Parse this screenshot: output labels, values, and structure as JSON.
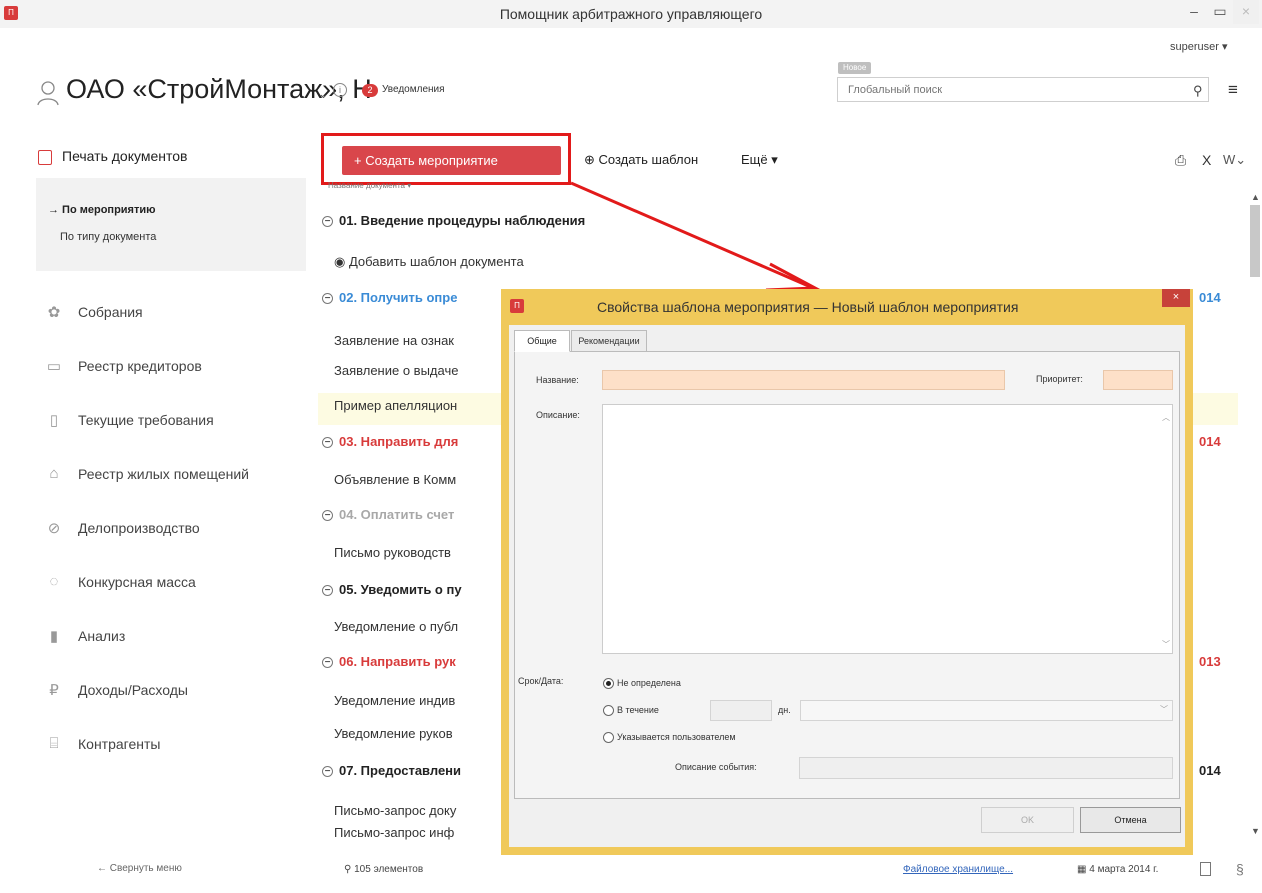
{
  "window": {
    "title": "Помощник арбитражного управляющего",
    "icon": "app-logo-icon"
  },
  "user": {
    "name": "superuser ▾"
  },
  "header": {
    "org_name": "ОАО «СтройМонтаж», Н",
    "notifications_count": "2",
    "notifications_label": "Уведомления",
    "new_tag": "Новое",
    "search_placeholder": "Глобальный поиск"
  },
  "sidebar": {
    "top_item": "Печать документов",
    "sub_items": [
      "→ По мероприятию",
      "По типу документа"
    ],
    "items": [
      {
        "label": "Собрания",
        "icon": "meeting-icon"
      },
      {
        "label": "Реестр кредиторов",
        "icon": "register-icon"
      },
      {
        "label": "Текущие требования",
        "icon": "document-icon"
      },
      {
        "label": "Реестр жилых помещений",
        "icon": "house-icon"
      },
      {
        "label": "Делопроизводство",
        "icon": "paperclip-icon"
      },
      {
        "label": "Конкурсная масса",
        "icon": "box-icon"
      },
      {
        "label": "Анализ",
        "icon": "bar-chart-icon"
      },
      {
        "label": "Доходы/Расходы",
        "icon": "ruble-icon"
      },
      {
        "label": "Контрагенты",
        "icon": "bank-icon"
      }
    ],
    "collapse_label": "← Свернуть меню"
  },
  "toolbar": {
    "create_event": "+ Создать мероприятие",
    "create_template": "⊕ Создать шаблон",
    "more": "Ещё ▾"
  },
  "list": {
    "column_header": "Название документа ▾",
    "rows": [
      {
        "kind": "group",
        "text": "01. Введение процедуры наблюдения",
        "color": "#222222"
      },
      {
        "kind": "doc",
        "text": "◉ Добавить шаблон документа"
      },
      {
        "kind": "group",
        "text": "02. Получить опре",
        "color": "#3a8bd6",
        "date": "014"
      },
      {
        "kind": "doc",
        "text": "Заявление на ознак"
      },
      {
        "kind": "doc",
        "text": "Заявление о выдаче"
      },
      {
        "kind": "doc",
        "text": "Пример апелляцион",
        "highlighted": true
      },
      {
        "kind": "group",
        "text": "03. Направить для",
        "color": "#d83b3b",
        "date": "014"
      },
      {
        "kind": "doc",
        "text": "Объявление в Комм"
      },
      {
        "kind": "group",
        "text": "04. Оплатить счет",
        "color": "#a8a8a8"
      },
      {
        "kind": "doc",
        "text": "Письмо руководств"
      },
      {
        "kind": "group",
        "text": "05. Уведомить о пу",
        "color": "#222222"
      },
      {
        "kind": "doc",
        "text": "Уведомление о публ"
      },
      {
        "kind": "group",
        "text": "06. Направить рук",
        "color": "#d83b3b",
        "date": "013"
      },
      {
        "kind": "doc",
        "text": "Уведомление индив"
      },
      {
        "kind": "doc",
        "text": "Уведомление руков"
      },
      {
        "kind": "group",
        "text": "07. Предоставлени",
        "color": "#222222",
        "date": "014"
      },
      {
        "kind": "doc",
        "text": "Письмо-запрос доку"
      },
      {
        "kind": "doc",
        "text": "Письмо-запрос инф"
      }
    ]
  },
  "status": {
    "count": "105 элементов",
    "file_storage": "Файловое хранилище...",
    "date": "4 марта 2014 г."
  },
  "dialog": {
    "title": "Свойства шаблона мероприятия — Новый шаблон мероприятия",
    "tabs": [
      "Общие",
      "Рекомендации"
    ],
    "name_label": "Название:",
    "priority_label": "Приоритет:",
    "description_label": "Описание:",
    "deadline_label": "Срок/Дата:",
    "radio_undefined": "Не определена",
    "radio_within": "В течение",
    "days_unit": "дн.",
    "radio_user": "Указывается пользователем",
    "event_desc_label": "Описание события:",
    "ok_label": "OK",
    "cancel_label": "Отмена"
  },
  "colors": {
    "accent_red": "#d9464b",
    "dialog_frame": "#f0c95a",
    "required_field": "#fde0c8"
  }
}
